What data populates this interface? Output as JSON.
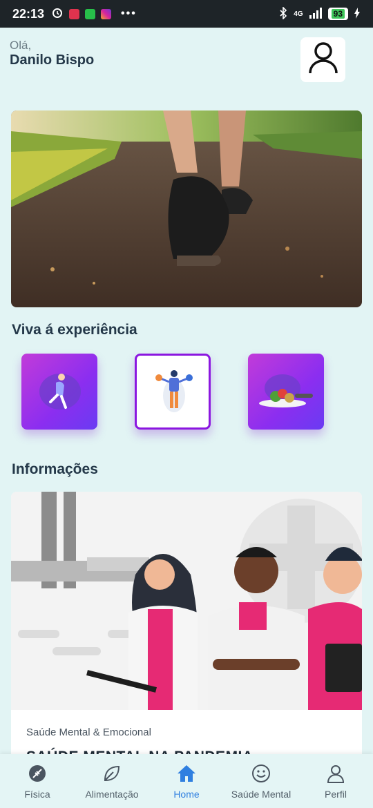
{
  "status_bar": {
    "time": "22:13",
    "network": "4G",
    "battery": "93"
  },
  "header": {
    "greeting": "Olá,",
    "user_name": "Danilo Bispo"
  },
  "sections": {
    "experience_title": "Viva á experiência",
    "info_title": "Informações"
  },
  "info_card": {
    "category": "Saúde Mental & Emocional",
    "title": "SAÚDE MENTAL NA PANDEMIA"
  },
  "bottom_nav": {
    "items": [
      {
        "label": "Física",
        "icon": "football-icon"
      },
      {
        "label": "Alimentação",
        "icon": "leaf-icon"
      },
      {
        "label": "Home",
        "icon": "home-icon",
        "active": true
      },
      {
        "label": "Saúde Mental",
        "icon": "smiley-icon"
      },
      {
        "label": "Perfil",
        "icon": "person-icon"
      }
    ]
  },
  "colors": {
    "background": "#e2f4f4",
    "accent_purple": "#8b16e0",
    "nav_active": "#2f7fe0",
    "text_dark": "#243849"
  }
}
